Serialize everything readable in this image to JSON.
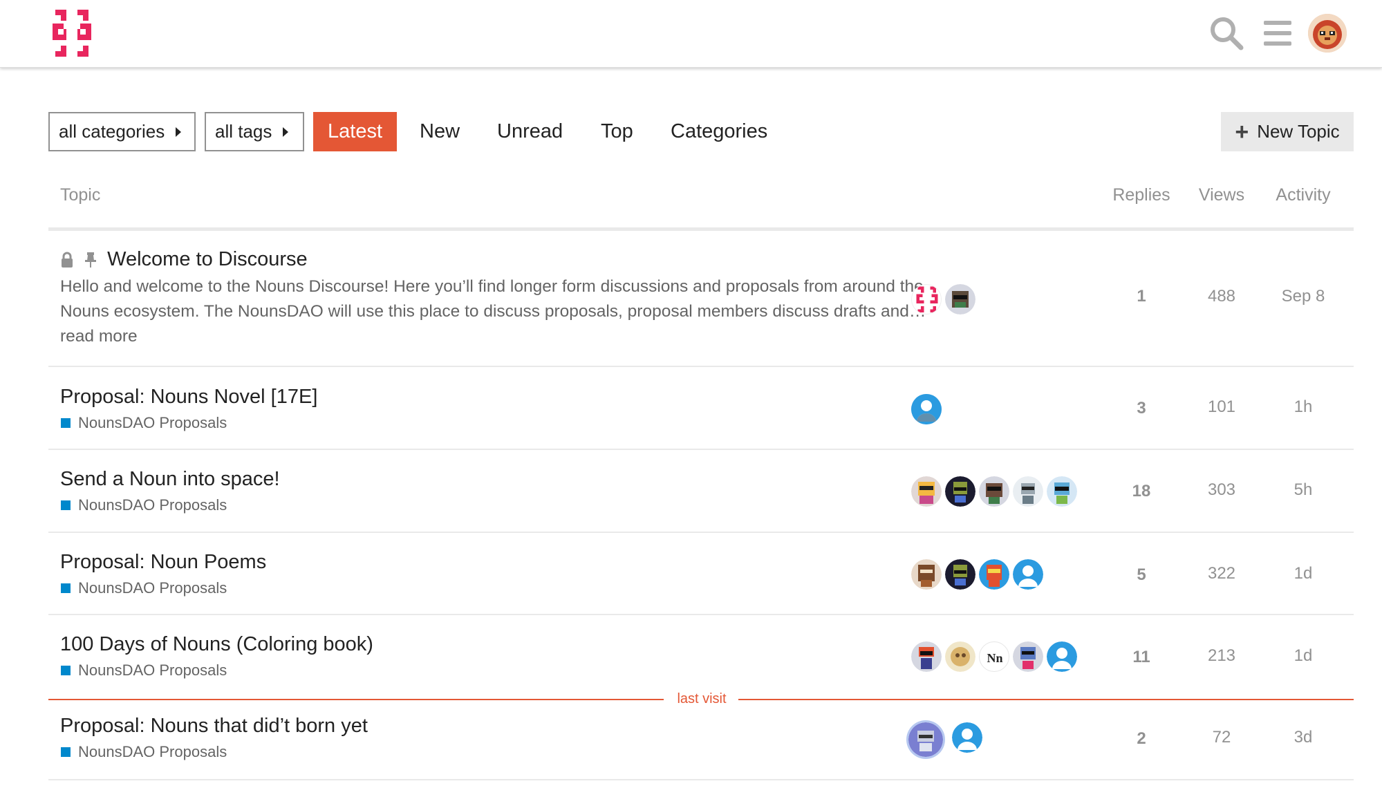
{
  "header": {
    "logo": "nouns-discourse-logo",
    "icons": [
      "search-icon",
      "hamburger-menu-icon",
      "user-avatar"
    ]
  },
  "nav": {
    "categories_dropdown": "all categories",
    "tags_dropdown": "all tags",
    "tabs": [
      {
        "label": "Latest",
        "active": true
      },
      {
        "label": "New",
        "active": false
      },
      {
        "label": "Unread",
        "active": false
      },
      {
        "label": "Top",
        "active": false
      },
      {
        "label": "Categories",
        "active": false
      }
    ],
    "new_topic": "New Topic"
  },
  "table": {
    "headers": {
      "topic": "Topic",
      "replies": "Replies",
      "views": "Views",
      "activity": "Activity"
    }
  },
  "topics": [
    {
      "title": "Welcome to Discourse",
      "status_icons": [
        "lock-icon",
        "pin-icon"
      ],
      "excerpt": "Hello and welcome to the Nouns Discourse! Here you’ll find longer form discussions and proposals from around the Nouns ecosystem. The NounsDAO will use this place to discuss proposals, proposal members discuss drafts and…",
      "read_more": "read more",
      "category": "",
      "posters": 2,
      "replies": "1",
      "views": "488",
      "activity": "Sep 8"
    },
    {
      "title": "Proposal: Nouns Novel [17E]",
      "category": "NounsDAO Proposals",
      "posters": 1,
      "replies": "3",
      "views": "101",
      "activity": "1h"
    },
    {
      "title": "Send a Noun into space!",
      "category": "NounsDAO Proposals",
      "posters": 5,
      "replies": "18",
      "views": "303",
      "activity": "5h"
    },
    {
      "title": "Proposal: Noun Poems",
      "category": "NounsDAO Proposals",
      "posters": 4,
      "replies": "5",
      "views": "322",
      "activity": "1d"
    },
    {
      "title": "100 Days of Nouns (Coloring book)",
      "category": "NounsDAO Proposals",
      "posters": 5,
      "replies": "11",
      "views": "213",
      "activity": "1d"
    },
    {
      "title": "Proposal: Nouns that did’t born yet",
      "category": "NounsDAO Proposals",
      "posters": 2,
      "replies": "2",
      "views": "72",
      "activity": "3d"
    }
  ],
  "last_visit_label": "last visit",
  "colors": {
    "accent": "#e45735",
    "category": "#0088cc",
    "brand_logo": "#e8265e",
    "muted_text": "#919191"
  }
}
